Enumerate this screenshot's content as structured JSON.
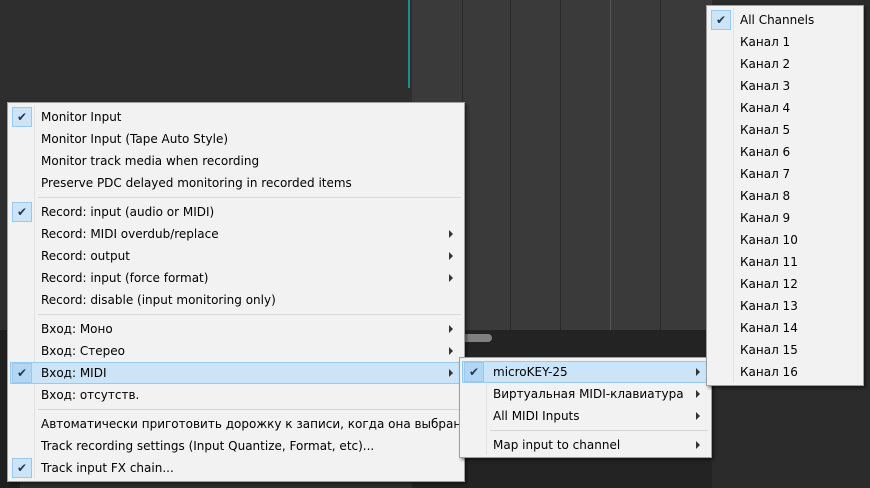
{
  "main_menu": {
    "items": [
      {
        "label": "Monitor Input",
        "checked": true,
        "submenu": false
      },
      {
        "label": "Monitor Input (Tape Auto Style)",
        "checked": false,
        "submenu": false
      },
      {
        "label": "Monitor track media when recording",
        "checked": false,
        "submenu": false
      },
      {
        "label": "Preserve PDC delayed monitoring in recorded items",
        "checked": false,
        "submenu": false
      },
      {
        "label": "Record: input (audio or MIDI)",
        "checked": true,
        "submenu": false
      },
      {
        "label": "Record: MIDI overdub/replace",
        "checked": false,
        "submenu": true
      },
      {
        "label": "Record: output",
        "checked": false,
        "submenu": true
      },
      {
        "label": "Record: input (force format)",
        "checked": false,
        "submenu": true
      },
      {
        "label": "Record: disable (input monitoring only)",
        "checked": false,
        "submenu": false
      },
      {
        "label": "Вход: Моно",
        "checked": false,
        "submenu": true
      },
      {
        "label": "Вход: Стерео",
        "checked": false,
        "submenu": true
      },
      {
        "label": "Вход: MIDI",
        "checked": true,
        "submenu": true,
        "highlighted": true
      },
      {
        "label": "Вход: отсутств.",
        "checked": false,
        "submenu": false
      },
      {
        "label": "Автоматически приготовить дорожку к записи, когда она выбрана",
        "checked": false,
        "submenu": false
      },
      {
        "label": "Track recording settings (Input Quantize, Format, etc)...",
        "checked": false,
        "submenu": false
      },
      {
        "label": "Track input FX chain...",
        "checked": true,
        "submenu": false
      }
    ]
  },
  "midi_menu": {
    "items": [
      {
        "label": "microKEY-25",
        "checked": true,
        "submenu": true,
        "highlighted": true
      },
      {
        "label": "Виртуальная MIDI-клавиатура",
        "checked": false,
        "submenu": true
      },
      {
        "label": "All MIDI Inputs",
        "checked": false,
        "submenu": true
      },
      {
        "label": "Map input to channel",
        "checked": false,
        "submenu": true
      }
    ]
  },
  "channel_menu": {
    "items": [
      {
        "label": "All Channels",
        "checked": true
      },
      {
        "label": "Канал 1"
      },
      {
        "label": "Канал 2"
      },
      {
        "label": "Канал 3"
      },
      {
        "label": "Канал 4"
      },
      {
        "label": "Канал 5"
      },
      {
        "label": "Канал 6"
      },
      {
        "label": "Канал 7"
      },
      {
        "label": "Канал 8"
      },
      {
        "label": "Канал 9"
      },
      {
        "label": "Канал 10"
      },
      {
        "label": "Канал 11"
      },
      {
        "label": "Канал 12"
      },
      {
        "label": "Канал 13"
      },
      {
        "label": "Канал 14"
      },
      {
        "label": "Канал 15"
      },
      {
        "label": "Канал 16"
      }
    ]
  },
  "icons": {
    "check": "check-icon",
    "arrow": "submenu-arrow-icon"
  }
}
